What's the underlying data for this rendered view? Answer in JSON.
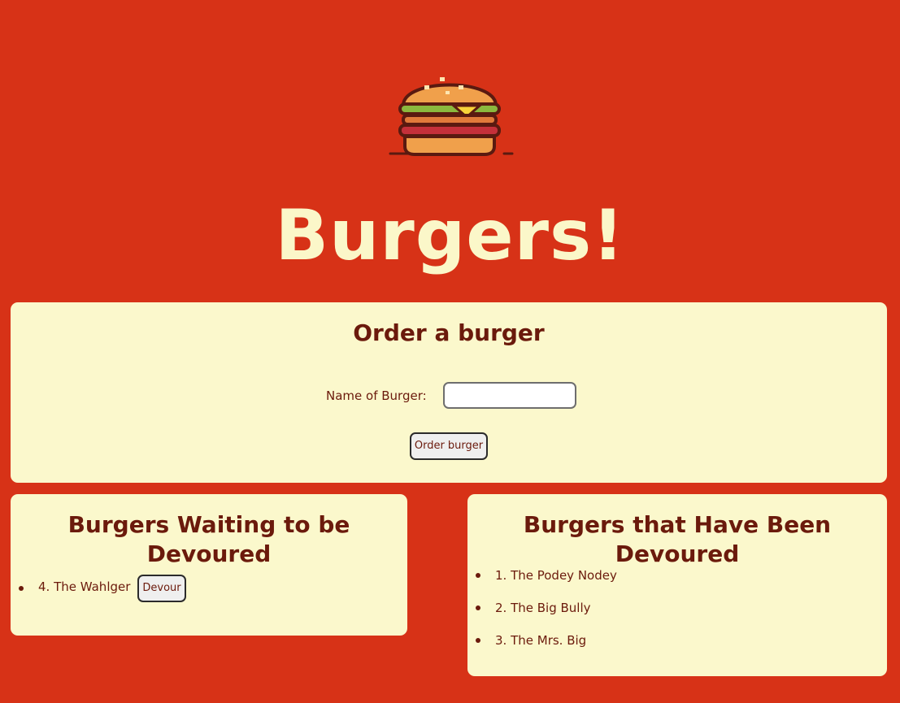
{
  "header": {
    "logo_icon": "burger-icon",
    "title": "Burgers!"
  },
  "order_form": {
    "heading": "Order a burger",
    "name_label": "Name of Burger:",
    "name_value": "",
    "name_placeholder": "",
    "submit_label": "Order burger"
  },
  "waiting": {
    "heading": "Burgers Waiting to be Devoured",
    "items": [
      {
        "label": "4. The Wahlger",
        "button_label": "Devour"
      }
    ]
  },
  "devoured": {
    "heading": "Burgers that Have Been Devoured",
    "items": [
      {
        "label": "1. The Podey Nodey"
      },
      {
        "label": "2. The Big Bully"
      },
      {
        "label": "3. The Mrs. Big"
      }
    ]
  },
  "colors": {
    "background": "#d73217",
    "panel": "#fbf8cc",
    "text": "#6b1a0c",
    "title": "#fbf7c9"
  }
}
